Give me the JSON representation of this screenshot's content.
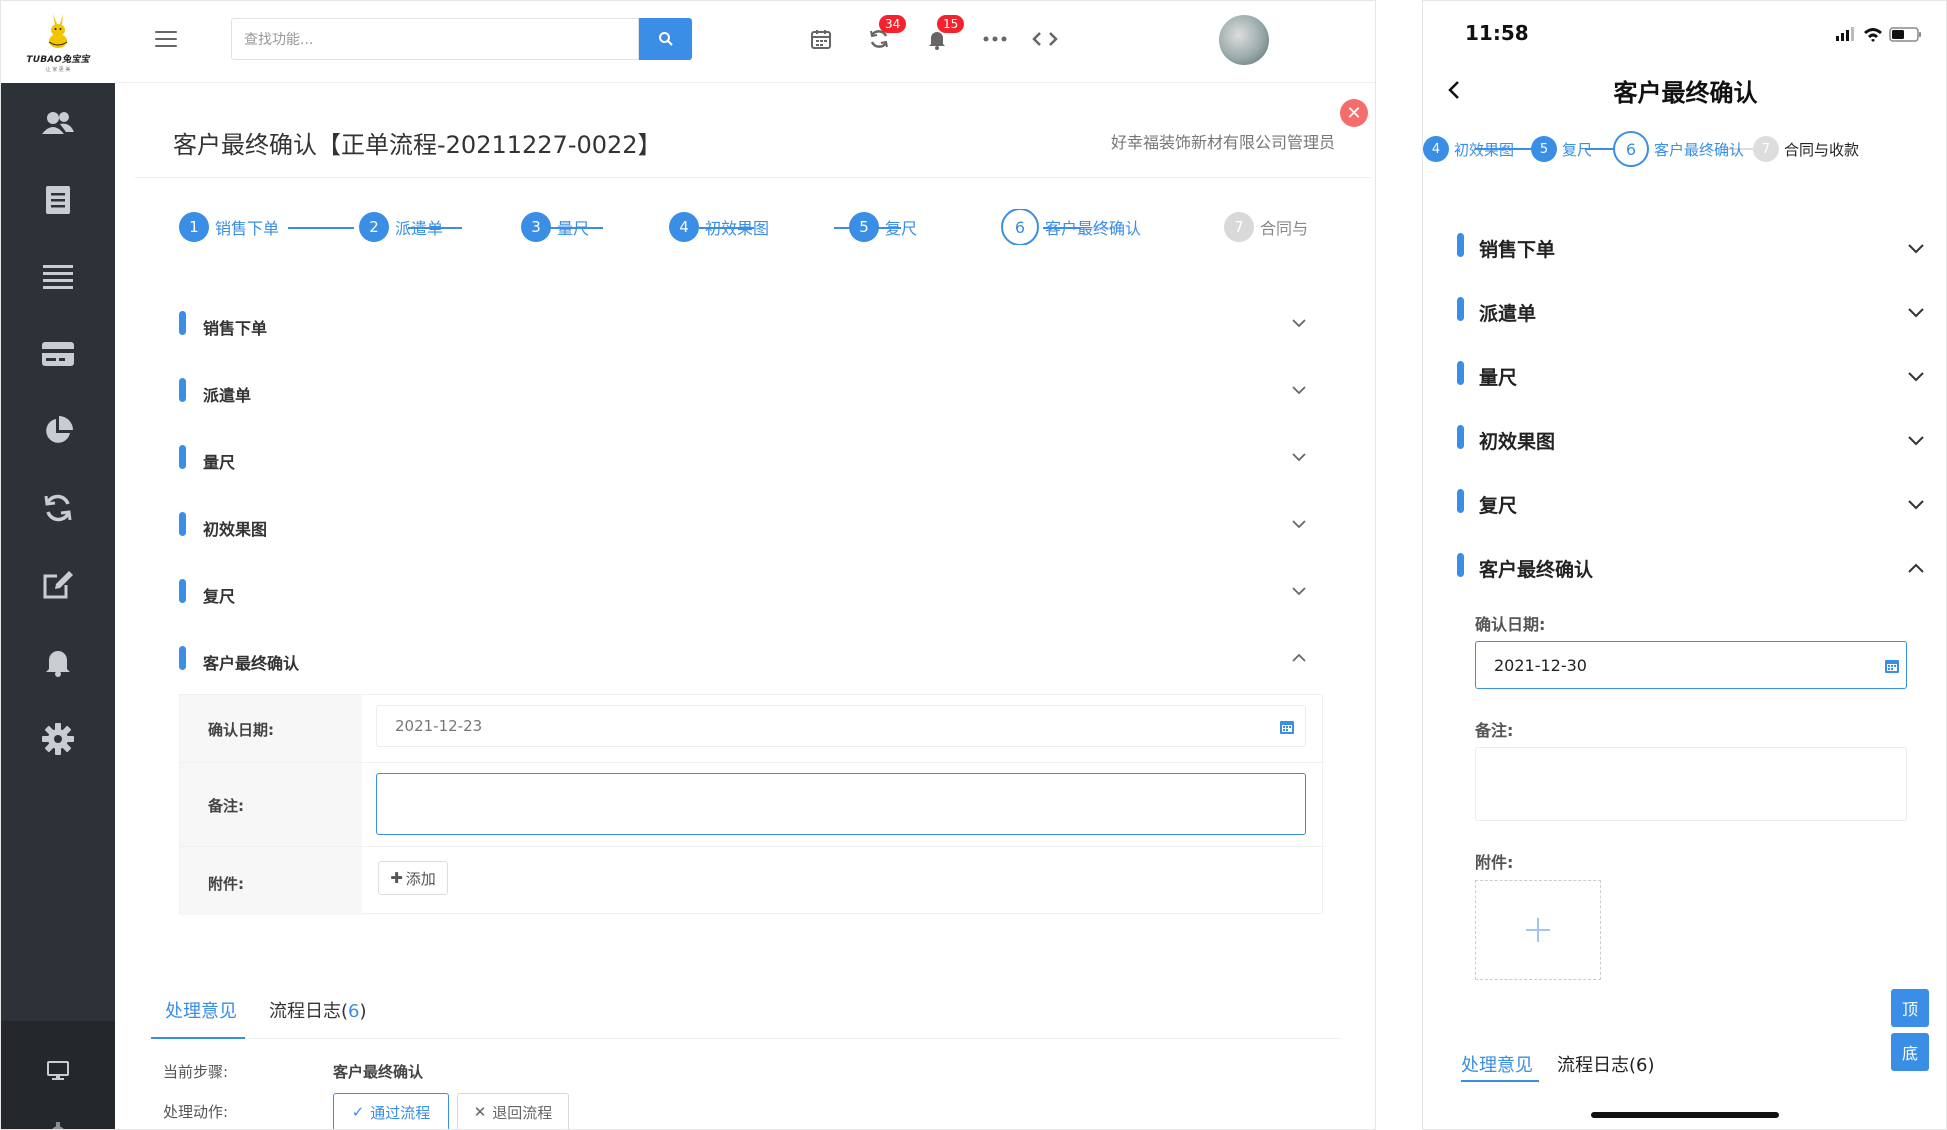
{
  "desktop": {
    "logo": {
      "text": "TUBAO兔宝宝",
      "sub": "让 家 更 美"
    },
    "search": {
      "placeholder": "查找功能..."
    },
    "header_badges": {
      "refresh_count": "34",
      "bell_count": "15"
    },
    "title": "客户最终确认【正单流程-20211227-0022】",
    "company": "好幸福装饰新材有限公司管理员",
    "steps": [
      {
        "num": "1",
        "label": "销售下单"
      },
      {
        "num": "2",
        "label": "派遣单"
      },
      {
        "num": "3",
        "label": "量尺"
      },
      {
        "num": "4",
        "label": "初效果图"
      },
      {
        "num": "5",
        "label": "复尺"
      },
      {
        "num": "6",
        "label": "客户最终确认"
      },
      {
        "num": "7",
        "label": "合同与收款"
      }
    ],
    "sections": [
      "销售下单",
      "派遣单",
      "量尺",
      "初效果图",
      "复尺",
      "客户最终确认"
    ],
    "form": {
      "date_label": "确认日期:",
      "date_value": "2021-12-23",
      "remark_label": "备注:",
      "attach_label": "附件:",
      "add_label": "添加"
    },
    "tabs": {
      "opinion": "处理意见",
      "log_label": "流程日志(",
      "log_count": "6",
      "log_close": ")"
    },
    "info": {
      "step_label": "当前步骤:",
      "step_value": "客户最终确认",
      "action_label": "处理动作:",
      "pass_label": "通过流程",
      "return_label": "退回流程"
    }
  },
  "mobile": {
    "time": "11:58",
    "title": "客户最终确认",
    "steps": [
      {
        "num": "4",
        "label": "初效果图"
      },
      {
        "num": "5",
        "label": "复尺"
      },
      {
        "num": "6",
        "label": "客户最终确认"
      },
      {
        "num": "7",
        "label": "合同与收款"
      }
    ],
    "sections": [
      "销售下单",
      "派遣单",
      "量尺",
      "初效果图",
      "复尺",
      "客户最终确认"
    ],
    "form": {
      "date_label": "确认日期:",
      "date_value": "2021-12-30",
      "remark_label": "备注:",
      "attach_label": "附件:"
    },
    "float": {
      "top": "顶",
      "bottom": "底"
    },
    "tabs": {
      "opinion": "处理意见",
      "log": "流程日志(6)"
    }
  },
  "colors": {
    "accent": "#3a8ee6",
    "sidebar": "#2d3238",
    "danger": "#f56c6c"
  },
  "icons": [
    "menu-icon",
    "search-icon",
    "calendar-icon",
    "refresh-icon",
    "bell-icon",
    "more-icon",
    "code-icon",
    "users-icon",
    "document-icon",
    "list-icon",
    "card-icon",
    "pie-chart-icon",
    "sync-icon",
    "edit-icon",
    "alarm-icon",
    "gear-icon",
    "monitor-icon",
    "close-icon",
    "chevron-down-icon",
    "chevron-up-icon",
    "plus-icon",
    "check-icon",
    "x-icon",
    "back-icon"
  ]
}
